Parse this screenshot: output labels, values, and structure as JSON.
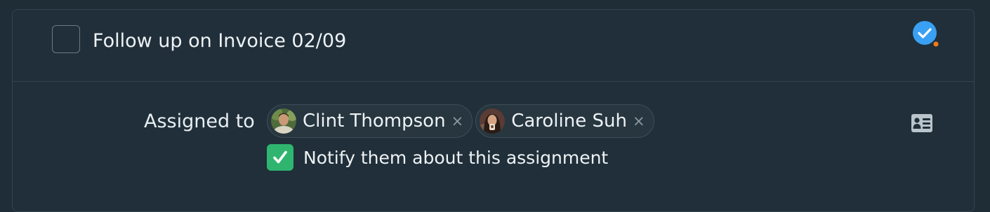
{
  "todo": {
    "title": "Follow up on Invoice 02/09",
    "completed": false,
    "status_icon": "check-circle-icon",
    "status_color": "#3aa0f3",
    "status_dot_color": "#f07a1a"
  },
  "assignment": {
    "label": "Assigned to",
    "assignees": [
      {
        "name": "Clint Thompson",
        "remove": "×",
        "avatar": "avatar-photo"
      },
      {
        "name": "Caroline Suh",
        "remove": "×",
        "avatar": "avatar-photo"
      }
    ],
    "notify": {
      "label": "Notify them about this assignment",
      "checked": true,
      "color": "#2fb56f"
    },
    "side_icon": "contact-card-icon"
  }
}
